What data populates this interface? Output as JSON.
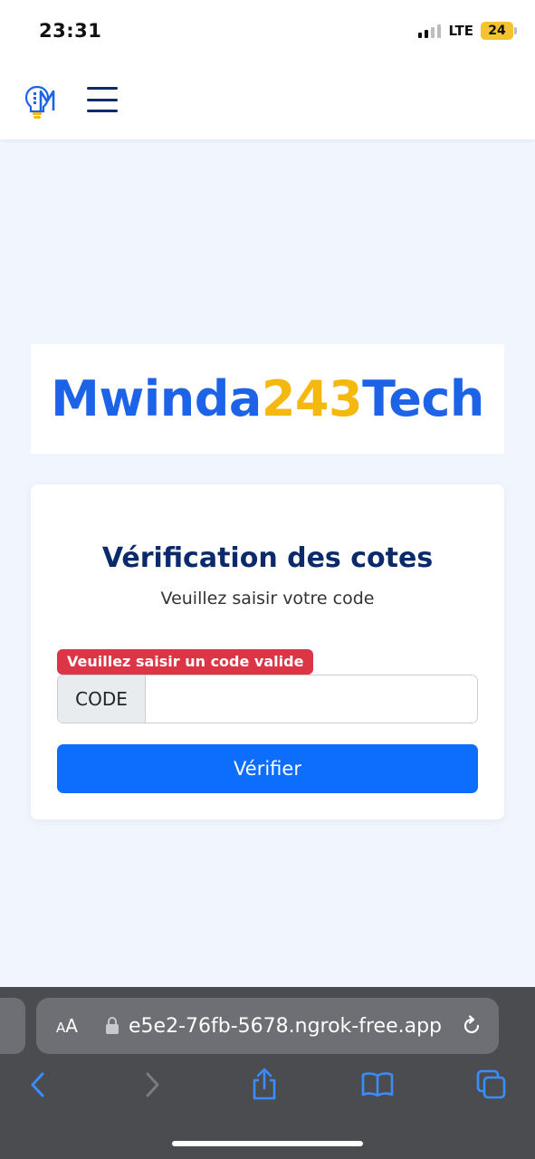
{
  "status_bar": {
    "time": "23:31",
    "network": "LTE",
    "battery": "24",
    "battery_color": "#f4c430"
  },
  "header": {
    "logo_icon": "lightbulb-m-logo-icon",
    "menu_icon": "hamburger-menu-icon"
  },
  "brand": {
    "part1": "Mwinda",
    "part2": "243",
    "part3": "Tech",
    "color_primary": "#1c63e8",
    "color_accent": "#f5b80f"
  },
  "verification": {
    "title": "Vérification des cotes",
    "subtitle": "Veuillez saisir votre code",
    "error_message": "Veuillez saisir un code valide",
    "input_label": "CODE",
    "input_value": "",
    "submit_label": "Vérifier",
    "button_color": "#0d6efd",
    "error_color": "#dc3545"
  },
  "browser": {
    "text_size_button": "AA",
    "url": "e5e2-76fb-5678.ngrok-free.app",
    "lock_icon": "lock-icon",
    "reload_icon": "reload-icon",
    "toolbar_icons": [
      "back-icon",
      "forward-icon",
      "share-icon",
      "bookmarks-icon",
      "tabs-icon"
    ]
  }
}
